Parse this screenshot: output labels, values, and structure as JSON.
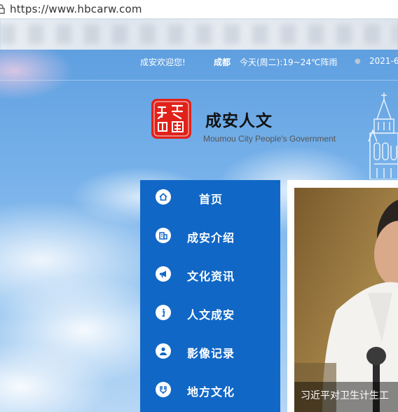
{
  "browser": {
    "url": "https://www.hbcarw.com"
  },
  "topbar": {
    "welcome": "成安欢迎您!",
    "city": "成都",
    "weather": "今天(周二):19~24℃阵雨",
    "date": "2021-6"
  },
  "header": {
    "title": "成安人文",
    "subtitle": "Moumou City People's Government"
  },
  "nav": {
    "items": [
      {
        "label": "首页",
        "icon": "home-icon"
      },
      {
        "label": "成安介绍",
        "icon": "building-icon"
      },
      {
        "label": "文化资讯",
        "icon": "megaphone-icon"
      },
      {
        "label": "人文成安",
        "icon": "info-icon"
      },
      {
        "label": "影像记录",
        "icon": "person-icon"
      },
      {
        "label": "地方文化",
        "icon": "handshake-icon"
      }
    ]
  },
  "news": {
    "caption": "习近平对卫生计生工"
  },
  "colors": {
    "nav_bg": "#1167c6",
    "seal_red": "#e0221a"
  }
}
